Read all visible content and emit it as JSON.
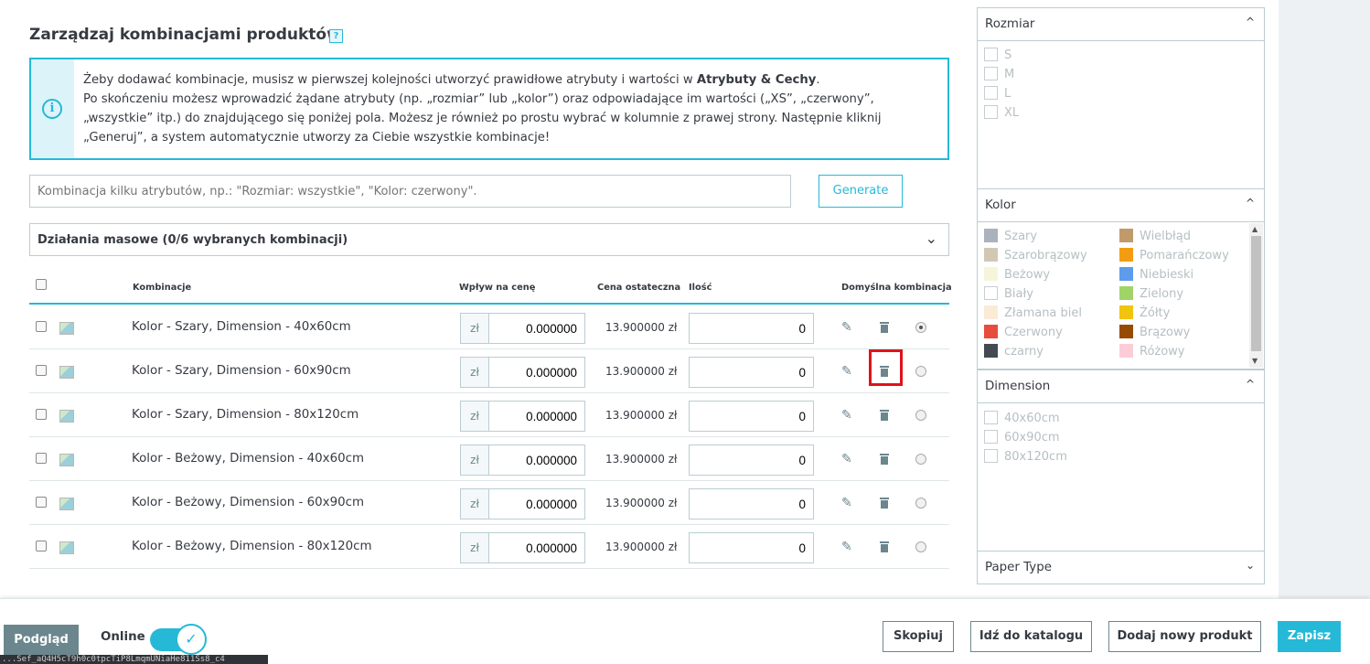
{
  "header": {
    "title": "Zarządzaj kombinacjami produktów",
    "help": "?"
  },
  "alert": {
    "line1_pre": "Żeby dodawać kombinacje, musisz w pierwszej kolejności utworzyć prawidłowe atrybuty i wartości w ",
    "line1_bold": "Atrybuty & Cechy",
    "line1_post": ".",
    "rest": "Po skończeniu możesz wprowadzić żądane atrybuty (np. „rozmiar” lub „kolor”) oraz odpowiadające im wartości („XS”, „czerwony”, „wszystkie” itp.) do znajdującego się poniżej pola. Możesz je również po prostu wybrać w kolumnie z prawej strony. Następnie kliknij „Generuj”, a system automatycznie utworzy za Ciebie wszystkie kombinacje!"
  },
  "combo": {
    "placeholder": "Kombinacja kilku atrybutów, np.: \"Rozmiar: wszystkie\", \"Kolor: czerwony\".",
    "generate_label": "Generate"
  },
  "bulk": {
    "label": "Działania masowe (0/6 wybranych kombinacji)"
  },
  "table": {
    "headers": {
      "name": "Kombinacje",
      "impact": "Wpływ na cenę",
      "final": "Cena ostateczna",
      "qty": "Ilość",
      "default": "Domyślna kombinacja"
    },
    "currency": "zł",
    "rows": [
      {
        "name": "Kolor - Szary, Dimension - 40x60cm",
        "impact": "0.000000",
        "final": "13.900000 zł",
        "qty": "0",
        "default": true
      },
      {
        "name": "Kolor - Szary, Dimension - 60x90cm",
        "impact": "0.000000",
        "final": "13.900000 zł",
        "qty": "0",
        "default": false
      },
      {
        "name": "Kolor - Szary, Dimension - 80x120cm",
        "impact": "0.000000",
        "final": "13.900000 zł",
        "qty": "0",
        "default": false
      },
      {
        "name": "Kolor - Beżowy, Dimension - 40x60cm",
        "impact": "0.000000",
        "final": "13.900000 zł",
        "qty": "0",
        "default": false
      },
      {
        "name": "Kolor - Beżowy, Dimension - 60x90cm",
        "impact": "0.000000",
        "final": "13.900000 zł",
        "qty": "0",
        "default": false
      },
      {
        "name": "Kolor - Beżowy, Dimension - 80x120cm",
        "impact": "0.000000",
        "final": "13.900000 zł",
        "qty": "0",
        "default": false
      }
    ]
  },
  "sidebar": {
    "rozmiar": {
      "title": "Rozmiar",
      "options": [
        "S",
        "M",
        "L",
        "XL"
      ]
    },
    "kolor": {
      "title": "Kolor",
      "left": [
        {
          "label": "Szary",
          "color": "#aab2bd"
        },
        {
          "label": "Szarobrązowy",
          "color": "#d1c8b4"
        },
        {
          "label": "Beżowy",
          "color": "#f5f5dc"
        },
        {
          "label": "Biały",
          "color": "#ffffff"
        },
        {
          "label": "Złamana biel",
          "color": "#faebd7"
        },
        {
          "label": "Czerwony",
          "color": "#e84c3d"
        },
        {
          "label": "czarny",
          "color": "#434a54"
        }
      ],
      "right": [
        {
          "label": "Wielbłąd",
          "color": "#c19a6b"
        },
        {
          "label": "Pomarańczowy",
          "color": "#f39c11"
        },
        {
          "label": "Niebieski",
          "color": "#5d9cec"
        },
        {
          "label": "Zielony",
          "color": "#a0d468"
        },
        {
          "label": "Żółty",
          "color": "#f1c40f"
        },
        {
          "label": "Brązowy",
          "color": "#964b00"
        },
        {
          "label": "Różowy",
          "color": "#fcccd9"
        }
      ]
    },
    "dimension": {
      "title": "Dimension",
      "options": [
        "40x60cm",
        "60x90cm",
        "80x120cm"
      ]
    },
    "paper": {
      "title": "Paper Type"
    }
  },
  "footer": {
    "preview": "Podgląd",
    "online": "Online",
    "url": "...Sef_aQ4H5cT9h0c0tpcTiP8LmqmUNiaHe811Ss8_c4",
    "duplicate": "Skopiuj",
    "catalog": "Idź do katalogu",
    "add_new": "Dodaj nowy produkt",
    "save": "Zapisz"
  },
  "colors": {
    "accent": "#25b9d7",
    "highlight": "#e0121b"
  }
}
